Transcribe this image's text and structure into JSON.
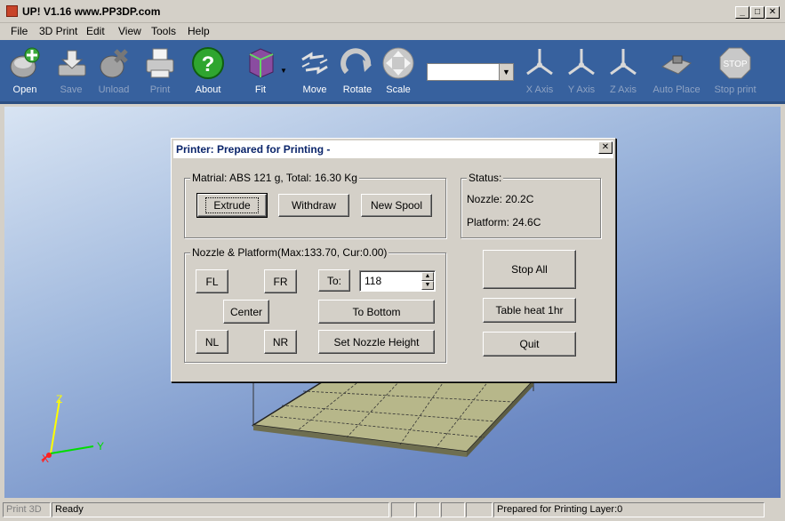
{
  "window": {
    "title": "UP! V1.16  www.PP3DP.com",
    "controls": {
      "minimize": "_",
      "maximize": "□",
      "close": "✕"
    }
  },
  "menu": [
    "File",
    "3D Print",
    "Edit",
    "View",
    "Tools",
    "Help"
  ],
  "toolbar": {
    "open": "Open",
    "save": "Save",
    "unload": "Unload",
    "print": "Print",
    "about": "About",
    "fit": "Fit",
    "move": "Move",
    "rotate": "Rotate",
    "scale": "Scale",
    "combo_value": "",
    "x_axis": "X Axis",
    "y_axis": "Y Axis",
    "z_axis": "Z Axis",
    "auto_place": "Auto Place",
    "stop_print": "Stop print",
    "stop_sign": "STOP"
  },
  "viewport": {
    "axis_z": "Z",
    "axis_y": "Y",
    "axis_x": "X"
  },
  "status_bar": {
    "mode": "Print 3D",
    "state": "Ready",
    "message": "Prepared for Printing Layer:0"
  },
  "dialog": {
    "title": "Printer: Prepared for Printing -",
    "close": "✕",
    "material_group": "Matrial: ABS 121 g,  Total: 16.30 Kg",
    "extrude": "Extrude",
    "withdraw": "Withdraw",
    "new_spool": "New Spool",
    "status_group": "Status:",
    "nozzle": "Nozzle: 20.2C",
    "platform": "Platform: 24.6C",
    "nozzle_group": "Nozzle & Platform(Max:133.70, Cur:0.00)",
    "fl": "FL",
    "fr": "FR",
    "center": "Center",
    "nl": "NL",
    "nr": "NR",
    "to_label": "To:",
    "to_value": "118",
    "to_bottom": "To Bottom",
    "set_nozzle_height": "Set Nozzle Height",
    "stop_all": "Stop All",
    "table_heat": "Table heat 1hr",
    "quit": "Quit"
  }
}
